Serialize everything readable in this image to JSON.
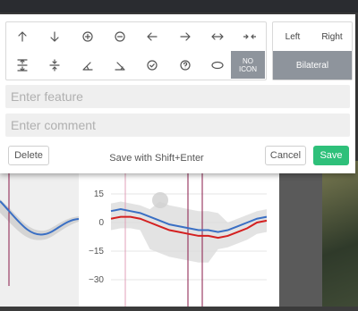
{
  "toolbar_icons": [
    {
      "name": "arrow-up-icon"
    },
    {
      "name": "arrow-down-icon"
    },
    {
      "name": "circle-plus-icon"
    },
    {
      "name": "circle-minus-icon"
    },
    {
      "name": "arrow-left-icon"
    },
    {
      "name": "arrow-right-icon"
    },
    {
      "name": "arrows-horizontal-icon"
    },
    {
      "name": "arrows-converge-icon"
    },
    {
      "name": "expand-vertical-icon"
    },
    {
      "name": "compress-vertical-icon"
    },
    {
      "name": "angle-open-icon"
    },
    {
      "name": "angle-closed-icon"
    },
    {
      "name": "circle-check-icon"
    },
    {
      "name": "circle-question-icon"
    },
    {
      "name": "ellipse-icon"
    }
  ],
  "no_icon_label": [
    "NO",
    "ICON"
  ],
  "side": {
    "left": "Left",
    "right": "Right",
    "bilateral": "Bilateral"
  },
  "feature": {
    "placeholder": "Enter feature",
    "value": ""
  },
  "comment": {
    "placeholder": "Enter comment",
    "value": ""
  },
  "buttons": {
    "delete": "Delete",
    "hint": "Save with Shift+Enter",
    "cancel": "Cancel",
    "save": "Save"
  },
  "colors": {
    "save": "#2ec07a",
    "selected": "#8e949c",
    "series_blue": "#3a6fc4",
    "series_red": "#d42020"
  },
  "chart_data": {
    "type": "line",
    "y_ticks": [
      "15",
      "0",
      "−15",
      "−30"
    ],
    "ylim": [
      -30,
      15
    ],
    "series": [
      {
        "values": [
          6,
          7,
          6,
          5,
          3,
          1,
          -1,
          -2,
          -3,
          -4,
          -4,
          -5,
          -4,
          -2,
          0,
          2,
          3
        ]
      },
      {
        "values": [
          2,
          3,
          3,
          2,
          0,
          -2,
          -4,
          -5,
          -6,
          -7,
          -7,
          -8,
          -7,
          -5,
          -3,
          0,
          1
        ]
      }
    ]
  }
}
